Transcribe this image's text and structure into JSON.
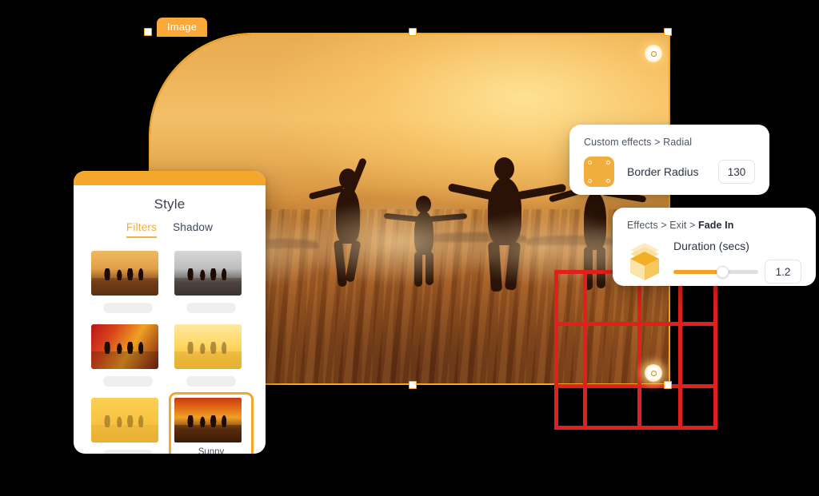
{
  "canvas": {
    "object_tag": "Image",
    "photo_alt": "four people running into ocean water at sunset, silhouetted"
  },
  "style_panel": {
    "title": "Style",
    "tabs": [
      {
        "label": "Filters",
        "active": true
      },
      {
        "label": "Shadow",
        "active": false
      }
    ],
    "filters": [
      {
        "name": "",
        "selected": false
      },
      {
        "name": "",
        "selected": false
      },
      {
        "name": "",
        "selected": false
      },
      {
        "name": "",
        "selected": false
      },
      {
        "name": "",
        "selected": false
      },
      {
        "name": "Sunny",
        "selected": true
      }
    ]
  },
  "radius_card": {
    "breadcrumb_prefix": "Custom effects > ",
    "breadcrumb_current": "Radial",
    "icon": "rounded-square-icon",
    "label": "Border Radius",
    "value": "130"
  },
  "fade_card": {
    "breadcrumb_prefix": "Effects > Exit > ",
    "breadcrumb_current": "Fade In",
    "icon": "cube-icon",
    "label": "Duration (secs)",
    "value": "1.2",
    "slider_percent": 58
  },
  "colors": {
    "accent": "#F5A623",
    "tab_active": "#F2AE3C",
    "grid_red": "#E0211B",
    "panel_header": "#F4A72A"
  }
}
